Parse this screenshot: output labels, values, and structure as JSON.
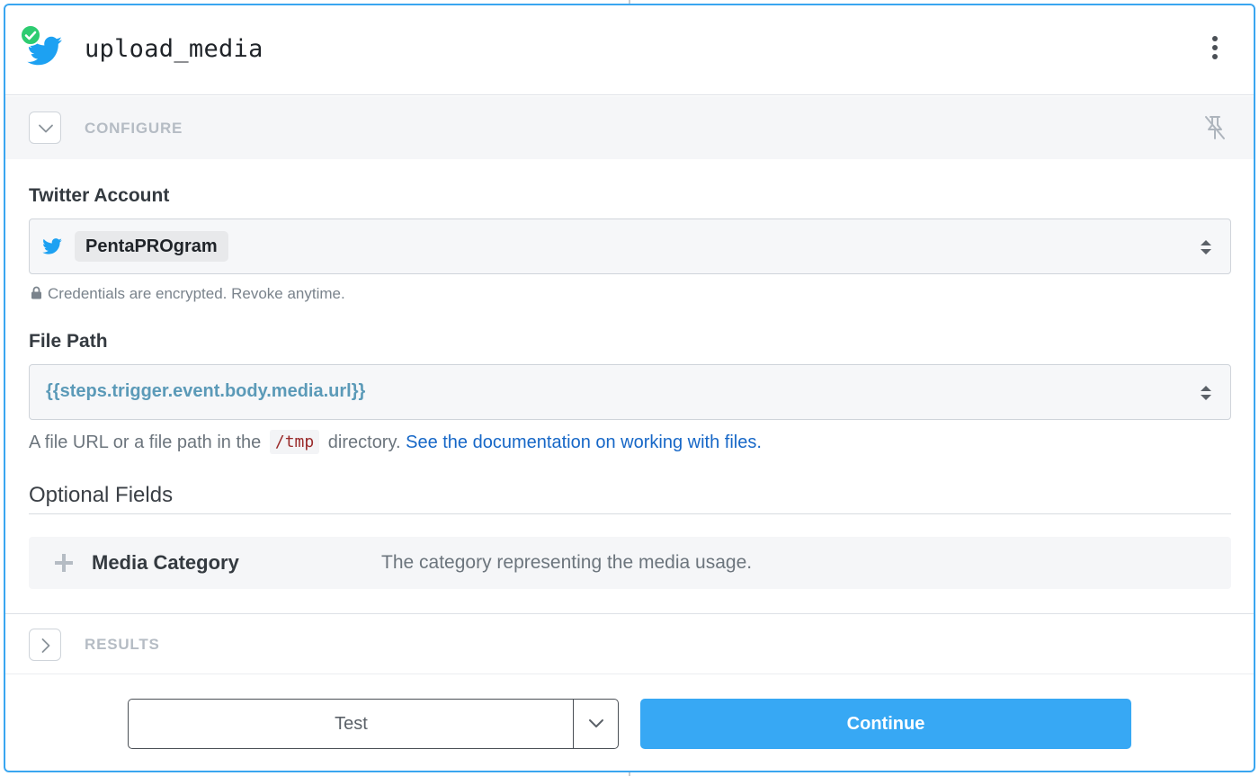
{
  "step": {
    "name": "upload_media",
    "app_icon": "twitter-bird-icon",
    "status_icon": "check-circle-icon",
    "menu_icon": "kebab-menu-icon"
  },
  "configure": {
    "label": "CONFIGURE",
    "toggle_icon": "chevron-down-icon",
    "pin_icon": "pin-off-icon"
  },
  "fields": {
    "twitter_account": {
      "label": "Twitter Account",
      "value": "PentaPROgram",
      "helper": "Credentials are encrypted. Revoke anytime."
    },
    "file_path": {
      "label": "File Path",
      "value": "{{steps.trigger.event.body.media.url}}",
      "helper_prefix": "A file URL or a file path in the",
      "helper_code": "/tmp",
      "helper_middle": "directory.",
      "helper_link": "See the documentation on working with files."
    }
  },
  "optional": {
    "title": "Optional Fields",
    "items": [
      {
        "name": "Media Category",
        "description": "The category representing the media usage."
      }
    ]
  },
  "results": {
    "label": "RESULTS",
    "toggle_icon": "chevron-right-icon"
  },
  "footer": {
    "test_label": "Test",
    "continue_label": "Continue"
  },
  "colors": {
    "accent": "#37a8f4",
    "twitter_blue": "#1da1f2",
    "success_green": "#2ecc71",
    "link": "#1667c7"
  }
}
